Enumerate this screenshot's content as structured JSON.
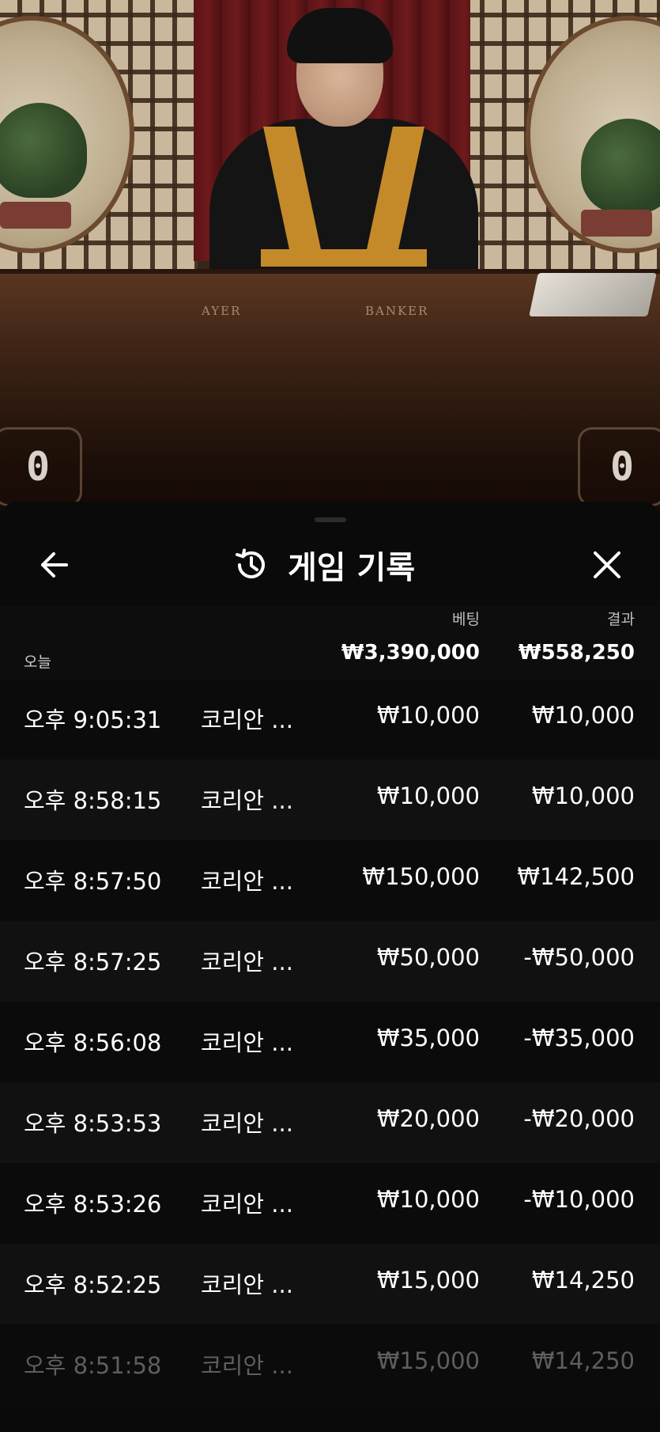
{
  "video": {
    "table_labels": {
      "player": "AYER",
      "banker": "BANKER"
    },
    "scores": {
      "left": "0",
      "right": "0"
    }
  },
  "sheet": {
    "title": "게임 기록",
    "icons": {
      "back": "arrow-left-icon",
      "history": "history-icon",
      "close": "close-icon"
    },
    "columns": {
      "bet": "베팅",
      "result": "결과"
    },
    "summary": {
      "label": "오늘",
      "bet": "₩3,390,000",
      "result": "₩558,250"
    },
    "rows": [
      {
        "time": "오후 9:05:31",
        "game": "코리안 ...",
        "bet": "₩10,000",
        "result": "₩10,000"
      },
      {
        "time": "오후 8:58:15",
        "game": "코리안 ...",
        "bet": "₩10,000",
        "result": "₩10,000"
      },
      {
        "time": "오후 8:57:50",
        "game": "코리안 ...",
        "bet": "₩150,000",
        "result": "₩142,500"
      },
      {
        "time": "오후 8:57:25",
        "game": "코리안 ...",
        "bet": "₩50,000",
        "result": "-₩50,000"
      },
      {
        "time": "오후 8:56:08",
        "game": "코리안 ...",
        "bet": "₩35,000",
        "result": "-₩35,000"
      },
      {
        "time": "오후 8:53:53",
        "game": "코리안 ...",
        "bet": "₩20,000",
        "result": "-₩20,000"
      },
      {
        "time": "오후 8:53:26",
        "game": "코리안 ...",
        "bet": "₩10,000",
        "result": "-₩10,000"
      },
      {
        "time": "오후 8:52:25",
        "game": "코리안 ...",
        "bet": "₩15,000",
        "result": "₩14,250"
      },
      {
        "time": "오후 8:51:58",
        "game": "코리안 ...",
        "bet": "₩15,000",
        "result": "₩14,250"
      }
    ]
  }
}
